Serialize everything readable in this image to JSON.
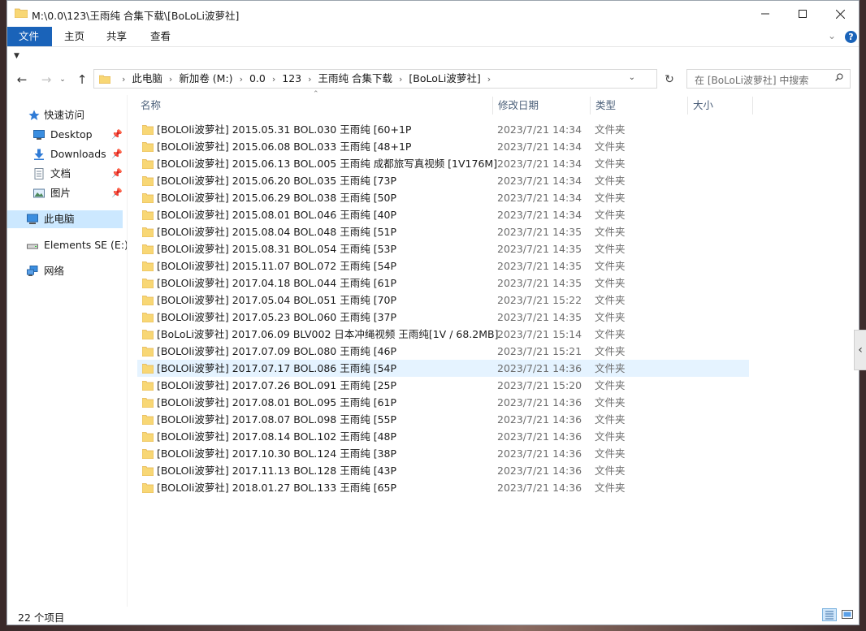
{
  "window": {
    "title": "M:\\0.0\\123\\王雨纯 合集下载\\[BoLoLi波萝社]"
  },
  "ribbon": {
    "file": "文件",
    "home": "主页",
    "share": "共享",
    "view": "查看"
  },
  "address": {
    "crumbs": [
      "此电脑",
      "新加卷 (M:)",
      "0.0",
      "123",
      "王雨纯 合集下载",
      "[BoLoLi波萝社]"
    ],
    "search_placeholder": "在 [BoLoLi波萝社] 中搜索"
  },
  "sidebar": {
    "quick_access": "快速访问",
    "desktop": "Desktop",
    "downloads": "Downloads",
    "documents": "文档",
    "pictures": "图片",
    "this_pc": "此电脑",
    "drive": "Elements SE (E:)",
    "network": "网络"
  },
  "columns": {
    "name": "名称",
    "date": "修改日期",
    "type": "类型",
    "size": "大小"
  },
  "files": [
    {
      "name": "[BOLOli波萝社] 2015.05.31 BOL.030 王雨纯 [60+1P",
      "date": "2023/7/21 14:34",
      "type": "文件夹"
    },
    {
      "name": "[BOLOli波萝社] 2015.06.08 BOL.033 王雨纯 [48+1P",
      "date": "2023/7/21 14:34",
      "type": "文件夹"
    },
    {
      "name": "[BOLOli波萝社] 2015.06.13 BOL.005 王雨纯 成都旅写真视频 [1V176M]",
      "date": "2023/7/21 14:34",
      "type": "文件夹"
    },
    {
      "name": "[BOLOli波萝社] 2015.06.20 BOL.035 王雨纯 [73P",
      "date": "2023/7/21 14:34",
      "type": "文件夹"
    },
    {
      "name": "[BOLOli波萝社] 2015.06.29 BOL.038 王雨纯 [50P",
      "date": "2023/7/21 14:34",
      "type": "文件夹"
    },
    {
      "name": "[BOLOli波萝社] 2015.08.01 BOL.046 王雨纯 [40P",
      "date": "2023/7/21 14:34",
      "type": "文件夹"
    },
    {
      "name": "[BOLOli波萝社] 2015.08.04 BOL.048 王雨纯 [51P",
      "date": "2023/7/21 14:35",
      "type": "文件夹"
    },
    {
      "name": "[BOLOli波萝社] 2015.08.31 BOL.054 王雨纯 [53P",
      "date": "2023/7/21 14:35",
      "type": "文件夹"
    },
    {
      "name": "[BOLOli波萝社] 2015.11.07 BOL.072 王雨纯 [54P",
      "date": "2023/7/21 14:35",
      "type": "文件夹"
    },
    {
      "name": "[BOLOli波萝社] 2017.04.18 BOL.044  王雨纯 [61P",
      "date": "2023/7/21 14:35",
      "type": "文件夹"
    },
    {
      "name": "[BOLOli波萝社] 2017.05.04 BOL.051 王雨纯 [70P",
      "date": "2023/7/21 15:22",
      "type": "文件夹"
    },
    {
      "name": "[BOLOli波萝社] 2017.05.23 BOL.060  王雨纯 [37P",
      "date": "2023/7/21 14:35",
      "type": "文件夹"
    },
    {
      "name": "[BoLoLi波萝社] 2017.06.09 BLV002 日本冲绳视频 王雨纯[1V / 68.2MB]",
      "date": "2023/7/21 15:14",
      "type": "文件夹"
    },
    {
      "name": "[BOLOli波萝社] 2017.07.09 BOL.080 王雨纯 [46P",
      "date": "2023/7/21 15:21",
      "type": "文件夹"
    },
    {
      "name": "[BOLOli波萝社] 2017.07.17 BOL.086  王雨纯 [54P",
      "date": "2023/7/21 14:36",
      "type": "文件夹"
    },
    {
      "name": "[BOLOli波萝社] 2017.07.26 BOL.091 王雨纯 [25P",
      "date": "2023/7/21 15:20",
      "type": "文件夹"
    },
    {
      "name": "[BOLOli波萝社] 2017.08.01 BOL.095 王雨纯 [61P",
      "date": "2023/7/21 14:36",
      "type": "文件夹"
    },
    {
      "name": "[BOLOli波萝社] 2017.08.07 BOL.098 王雨纯 [55P",
      "date": "2023/7/21 14:36",
      "type": "文件夹"
    },
    {
      "name": "[BOLOli波萝社] 2017.08.14 BOL.102  王雨纯 [48P",
      "date": "2023/7/21 14:36",
      "type": "文件夹"
    },
    {
      "name": "[BOLOli波萝社] 2017.10.30 BOL.124 王雨纯 [38P",
      "date": "2023/7/21 14:36",
      "type": "文件夹"
    },
    {
      "name": "[BOLOli波萝社] 2017.11.13 BOL.128 王雨纯 [43P",
      "date": "2023/7/21 14:36",
      "type": "文件夹"
    },
    {
      "name": "[BOLOli波萝社] 2018.01.27 BOL.133 王雨纯 [65P",
      "date": "2023/7/21 14:36",
      "type": "文件夹"
    }
  ],
  "hover_index": 14,
  "status": {
    "count": "22 个项目"
  },
  "colors": {
    "accent": "#1a63b9",
    "folder": "#f8d775",
    "folder_dark": "#e8b94a",
    "hover": "#e5f3ff",
    "selected": "#cce8ff"
  }
}
